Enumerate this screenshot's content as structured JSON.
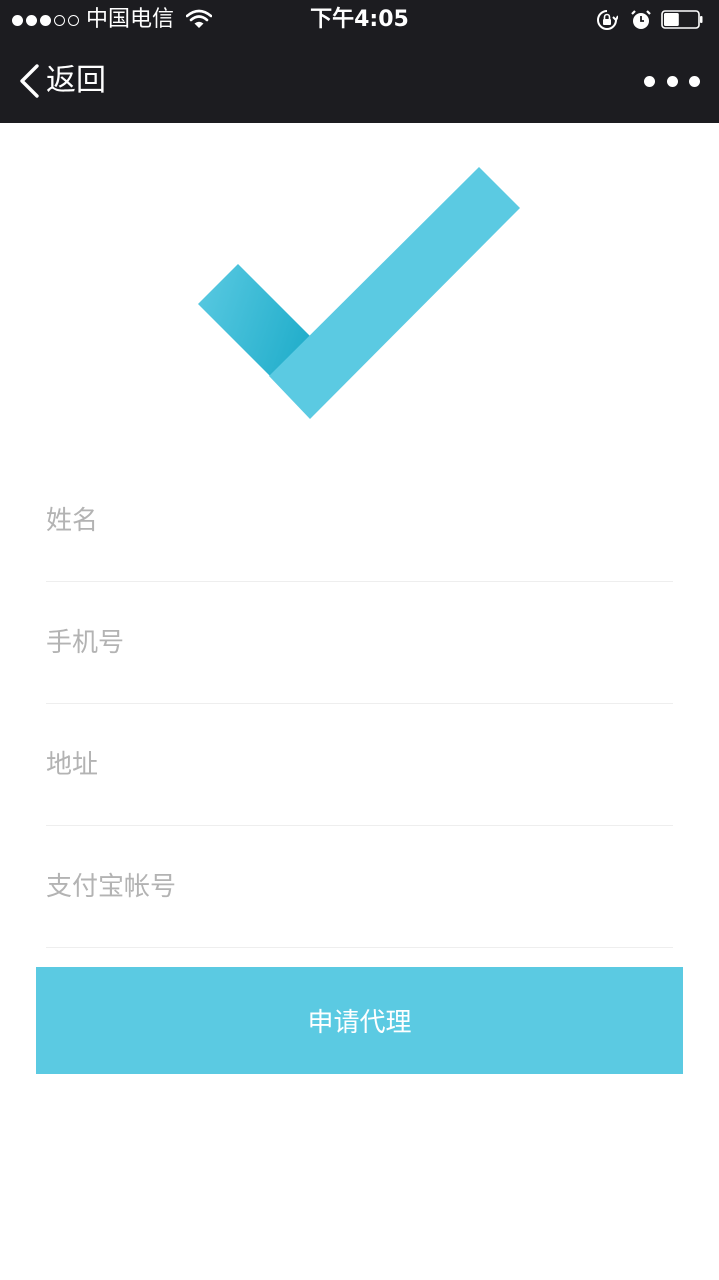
{
  "status_bar": {
    "carrier": "●●●○○ 中国电信",
    "carrier_text": "中国电信",
    "signal_strength": 3,
    "signal_max": 5,
    "time": "下午4:05",
    "battery_level": 0.45
  },
  "nav": {
    "back_label": "返回",
    "more_icon": "ellipsis-icon"
  },
  "icons": {
    "check": "checkmark-icon",
    "back": "chevron-left-icon",
    "wifi": "wifi-icon",
    "lock": "rotation-lock-icon",
    "alarm": "alarm-icon",
    "battery": "battery-icon"
  },
  "form": {
    "fields": [
      {
        "placeholder": "姓名",
        "value": ""
      },
      {
        "placeholder": "手机号",
        "value": ""
      },
      {
        "placeholder": "地址",
        "value": ""
      },
      {
        "placeholder": "支付宝帐号",
        "value": ""
      }
    ],
    "submit_label": "申请代理"
  },
  "colors": {
    "accent": "#5bcae2",
    "accent_dark": "#22aecb",
    "topbar": "#1c1c20",
    "placeholder": "#b3b3b3",
    "divider": "#eeeeee"
  }
}
